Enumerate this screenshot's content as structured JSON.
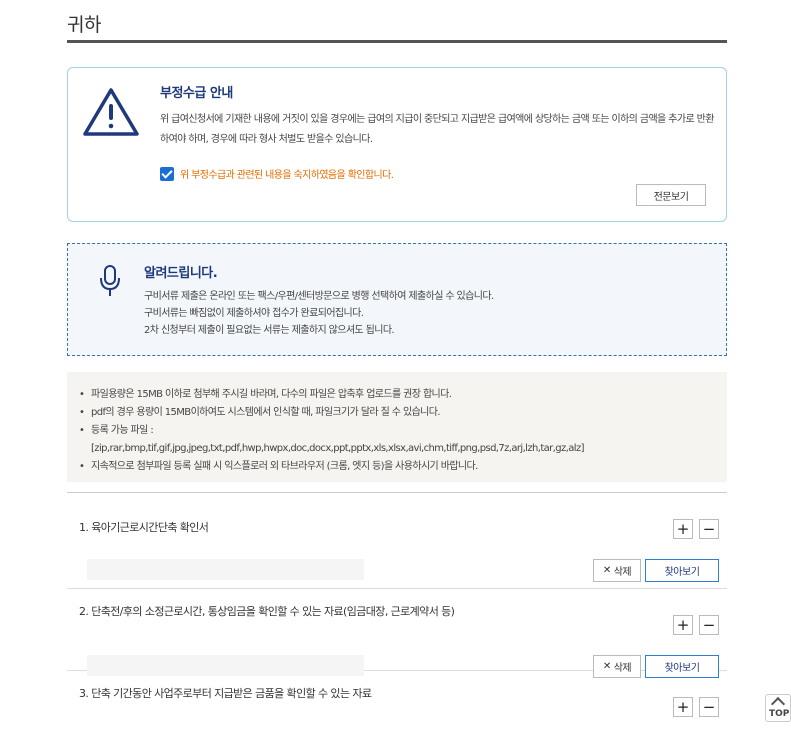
{
  "page": {
    "title": "귀하"
  },
  "warning": {
    "title": "부정수급 안내",
    "description": "위 급여신청서에 기재한 내용에 거짓이 있을 경우에는 급여의 지급이 중단되고 지급받은 급여액에 상당하는 금액 또는 이하의 금액을 추가로 반환하여야 하며, 경우에 따라 형사 처벌도 받을수 있습니다.",
    "check_label": "위 부정수급과 관련된 내용을 숙지하였음을 확인합니다.",
    "checked": true,
    "full_text_button": "전문보기"
  },
  "notice": {
    "title": "알려드립니다.",
    "lines": [
      "구비서류 제출은 온라인 또는 팩스/우편/센터방문으로 병행 선택하여 제출하실 수 있습니다.",
      "구비서류는 빠짐없이 제출하셔야 접수가 완료되어집니다.",
      "2차 신청부터 제출이 필요없는 서류는 제출하지 않으셔도 됩니다."
    ]
  },
  "info": {
    "items": [
      "파일용량은 15MB 이하로 첨부해 주시길 바라며, 다수의 파일은 압축후 업로드를 권장 합니다.",
      "pdf의 경우 용량이 15MB이하여도 시스템에서 인식할 때, 파일크기가 달라 질 수 있습니다.",
      "등록 가능 파일 :",
      "[zip,rar,bmp,tif,gif,jpg,jpeg,txt,pdf,hwp,hwpx,doc,docx,ppt,pptx,xls,xlsx,avi,chm,tiff,png,psd,7z,arj,lzh,tar,gz,alz]",
      "지속적으로 첨부파일 등록 실패 시 익스플로러 외 타브라우저 (크롬, 엣지 등)을 사용하시기 바랍니다."
    ]
  },
  "files": {
    "plus": "+",
    "minus": "−",
    "delete_label": "삭제",
    "find_label": "찾아보기",
    "rows": [
      {
        "label": "1. 육아기근로시간단축 확인서"
      },
      {
        "label": "2. 단축전/후의 소정근로시간, 통상임금을 확인할 수 있는 자료(임금대장, 근로계약서 등)"
      },
      {
        "label": "3. 단축 기간동안 사업주로부터 지급받은 금품을 확인할 수 있는 자료"
      }
    ]
  },
  "top_button": {
    "label": "TOP"
  }
}
